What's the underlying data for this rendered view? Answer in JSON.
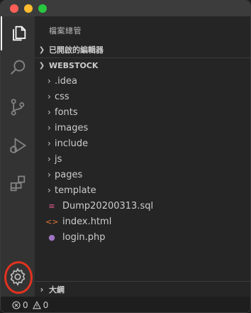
{
  "sidebar": {
    "title": "檔案總管",
    "open_editors_label": "已開啟的編輯器",
    "workspace_label": "WEBSTOCK",
    "outline_label": "大綱",
    "tree": [
      {
        "label": ".idea",
        "kind": "folder"
      },
      {
        "label": "css",
        "kind": "folder"
      },
      {
        "label": "fonts",
        "kind": "folder"
      },
      {
        "label": "images",
        "kind": "folder"
      },
      {
        "label": "include",
        "kind": "folder"
      },
      {
        "label": "js",
        "kind": "folder"
      },
      {
        "label": "pages",
        "kind": "folder"
      },
      {
        "label": "template",
        "kind": "folder"
      },
      {
        "label": "Dump20200313.sql",
        "kind": "sql-file"
      },
      {
        "label": "index.html",
        "kind": "html-file"
      },
      {
        "label": "login.php",
        "kind": "php-file"
      }
    ]
  },
  "activity_bar": [
    "explorer-icon",
    "search-icon",
    "source-control-icon",
    "run-debug-icon",
    "extensions-icon",
    "settings-gear-icon"
  ],
  "status": {
    "errors": "0",
    "warnings": "0"
  },
  "colors": {
    "highlight_ring": "#e0321f",
    "sql_icon": "#e05a8a",
    "html_icon": "#e37933",
    "php_icon": "#a074c4"
  }
}
